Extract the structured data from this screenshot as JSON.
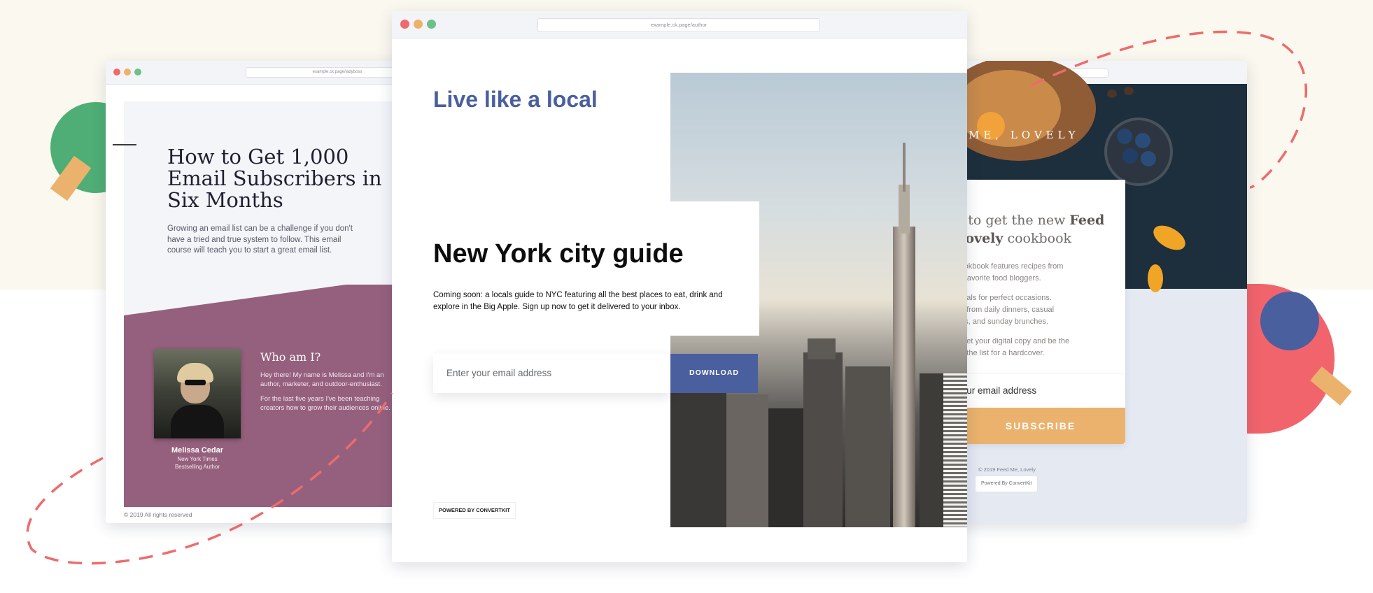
{
  "colors": {
    "accent_blue": "#4a5f9e",
    "mauve": "#95607d",
    "orange": "#ebb26d",
    "coral": "#f2646c",
    "green": "#4fae75",
    "cream": "#fbf8ef",
    "dash": "#ec6c6c"
  },
  "left_window": {
    "url": "example.ck.page/ladyboss",
    "title": "How to Get 1,000 Email Subscribers in Six Months",
    "intro": "Growing an email list can be a challenge if you don't have a tried and true system to follow. This email course will teach you to start a great email list.",
    "who_heading": "Who am I?",
    "who_p1": "Hey there! My name is Melissa and I'm an author, marketer, and outdoor-enthusiast.",
    "who_p2": "For the last five years I've been teaching creators how to grow their audiences online.",
    "author_name": "Melissa Cedar",
    "author_sub1": "New York Times",
    "author_sub2": "Bestselling Author",
    "footer": "© 2019 All rights reserved"
  },
  "center_window": {
    "url": "example.ck.page/author",
    "tagline": "Live like a local",
    "title": "New York city guide",
    "description": "Coming soon: a locals guide to NYC featuring all the best places to eat, drink and explore in the Big Apple. Sign up now to get it delivered to your inbox.",
    "email_placeholder": "Enter your email address",
    "button_label": "DOWNLOAD",
    "powered_by": "POWERED BY CONVERTKIT"
  },
  "right_window": {
    "url": "example.ck.page/cooking",
    "banner_text": "ME, LOVELY",
    "heading_part1": "e to get the new ",
    "heading_bold1": "Feed",
    "heading_bold2": "Lovely",
    "heading_part2": " cookbook",
    "p1": "cookbook features recipes from\nur favorite food bloggers.",
    "p2": "meals for perfect occasions.\nng from daily dinners, casual\nnes, and sunday brunches.",
    "p3": "o get your digital copy and be the\non the list for a hardcover.",
    "email_placeholder": "Your email address",
    "button_label": "SUBSCRIBE",
    "footer": "© 2019 Feed Me, Lovely",
    "powered_by": "Powered By ConvertKit"
  }
}
